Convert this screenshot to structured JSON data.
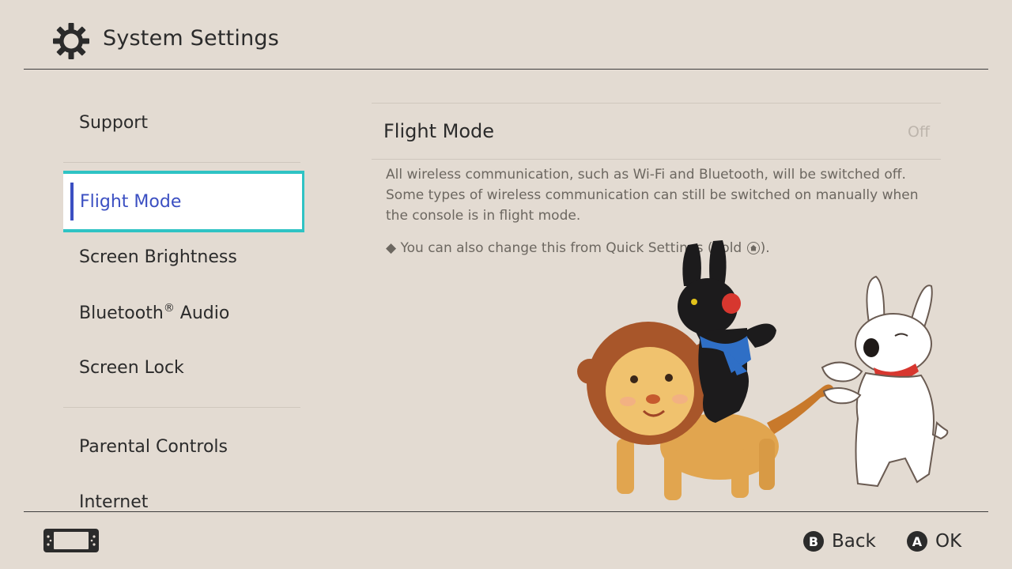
{
  "header": {
    "title": "System Settings",
    "icon": "gear-icon"
  },
  "sidebar": {
    "items": [
      {
        "label": "Support",
        "selected": false
      },
      {
        "label": "Flight Mode",
        "selected": true
      },
      {
        "label": "Screen Brightness",
        "selected": false
      },
      {
        "label": "Bluetooth",
        "label_suffix": "®",
        "label_rest": " Audio",
        "selected": false
      },
      {
        "label": "Screen Lock",
        "selected": false
      },
      {
        "label": "Parental Controls",
        "selected": false
      },
      {
        "label": "Internet",
        "selected": false
      }
    ]
  },
  "detail": {
    "title": "Flight Mode",
    "value": "Off",
    "description": "All wireless communication, such as Wi-Fi and Bluetooth, will be switched off. Some types of wireless communication can still be switched on manually when the console is in flight mode.",
    "note_bullet": "◆",
    "note_prefix": "You can also change this from Quick Settings (hold ",
    "note_suffix": ")."
  },
  "footer": {
    "console_icon": "handheld-console-icon",
    "back_glyph": "B",
    "back_label": "Back",
    "ok_glyph": "A",
    "ok_label": "OK"
  },
  "colors": {
    "background": "#e3dbd2",
    "selection_border": "#2fc3c4",
    "selection_text": "#3b4fc2",
    "value_off": "#bdb5ac"
  }
}
